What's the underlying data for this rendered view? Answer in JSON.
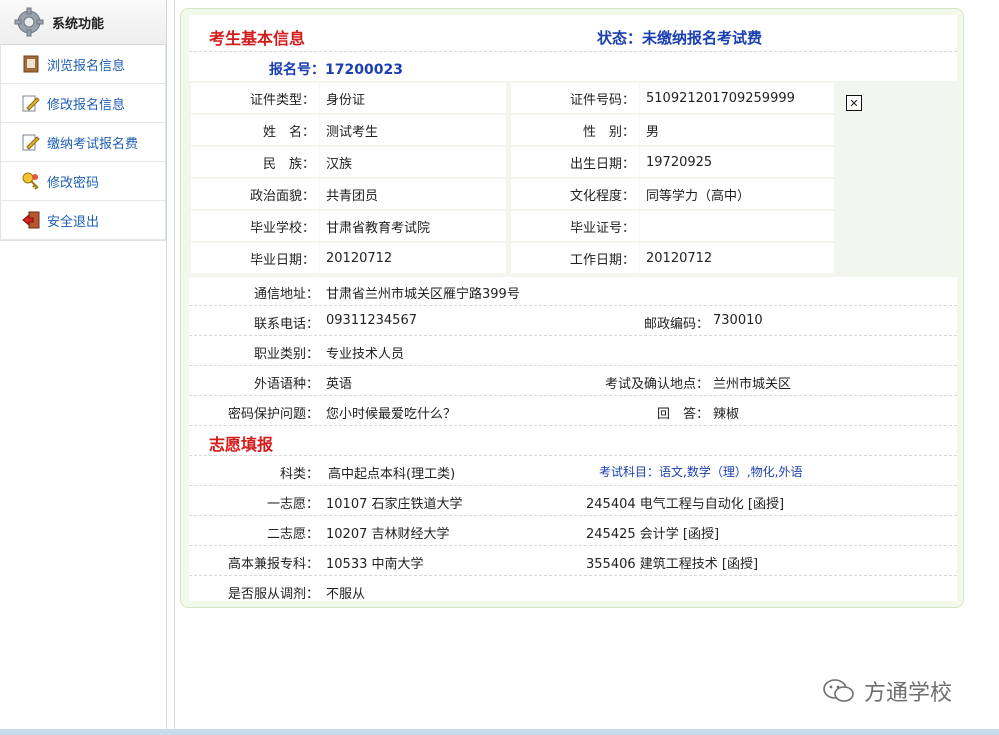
{
  "sidebar": {
    "header_label": "系统功能",
    "items": [
      {
        "label": "浏览报名信息",
        "icon": "book-icon"
      },
      {
        "label": "修改报名信息",
        "icon": "edit-icon"
      },
      {
        "label": "缴纳考试报名费",
        "icon": "edit-icon"
      },
      {
        "label": "修改密码",
        "icon": "key-icon"
      },
      {
        "label": "安全退出",
        "icon": "exit-icon"
      }
    ]
  },
  "info": {
    "section_title": "考生基本信息",
    "status": "状态：未缴纳报名考试费",
    "reg_no": "报名号：17200023",
    "rows": [
      {
        "l1": "证件类型：",
        "v1": "身份证",
        "l2": "证件号码：",
        "v2": "510921201709259999"
      },
      {
        "l1": "姓　名：",
        "v1": "测试考生",
        "l2": "性　别：",
        "v2": "男"
      },
      {
        "l1": "民　族：",
        "v1": "汉族",
        "l2": "出生日期：",
        "v2": "19720925"
      },
      {
        "l1": "政治面貌：",
        "v1": "共青团员",
        "l2": "文化程度：",
        "v2": "同等学力（高中）"
      },
      {
        "l1": "毕业学校：",
        "v1": "甘肃省教育考试院",
        "l2": "毕业证号：",
        "v2": ""
      },
      {
        "l1": "毕业日期：",
        "v1": "20120712",
        "l2": "工作日期：",
        "v2": "20120712"
      }
    ],
    "address_label": "通信地址：",
    "address": "甘肃省兰州市城关区雁宁路399号",
    "phone_label": "联系电话：",
    "phone": "09311234567",
    "zip_label": "邮政编码：",
    "zip": "730010",
    "job_label": "职业类别：",
    "job": "专业技术人员",
    "lang_label": "外语语种：",
    "lang": "英语",
    "site_label": "考试及确认地点：",
    "site": "兰州市城关区",
    "q_label": "密码保护问题：",
    "question": "您小时候最爱吃什么？",
    "a_label": "回　答：",
    "answer": "辣椒"
  },
  "wish": {
    "section_title": "志愿填报",
    "category_label": "科类：",
    "category": "高中起点本科(理工类)",
    "subjects": "考试科目：语文,数学（理）,物化,外语",
    "first_label": "一志愿：",
    "first_school": "10107 石家庄铁道大学",
    "first_major": "245404 电气工程与自动化 [函授]",
    "second_label": "二志愿：",
    "second_school": "10207 吉林财经大学",
    "second_major": "245425 会计学 [函授]",
    "extra_label": "高本兼报专科：",
    "extra_school": "10533 中南大学",
    "extra_major": "355406 建筑工程技术 [函授]",
    "adjust_label": "是否服从调剂：",
    "adjust": "不服从"
  },
  "watermark": "方通学校"
}
